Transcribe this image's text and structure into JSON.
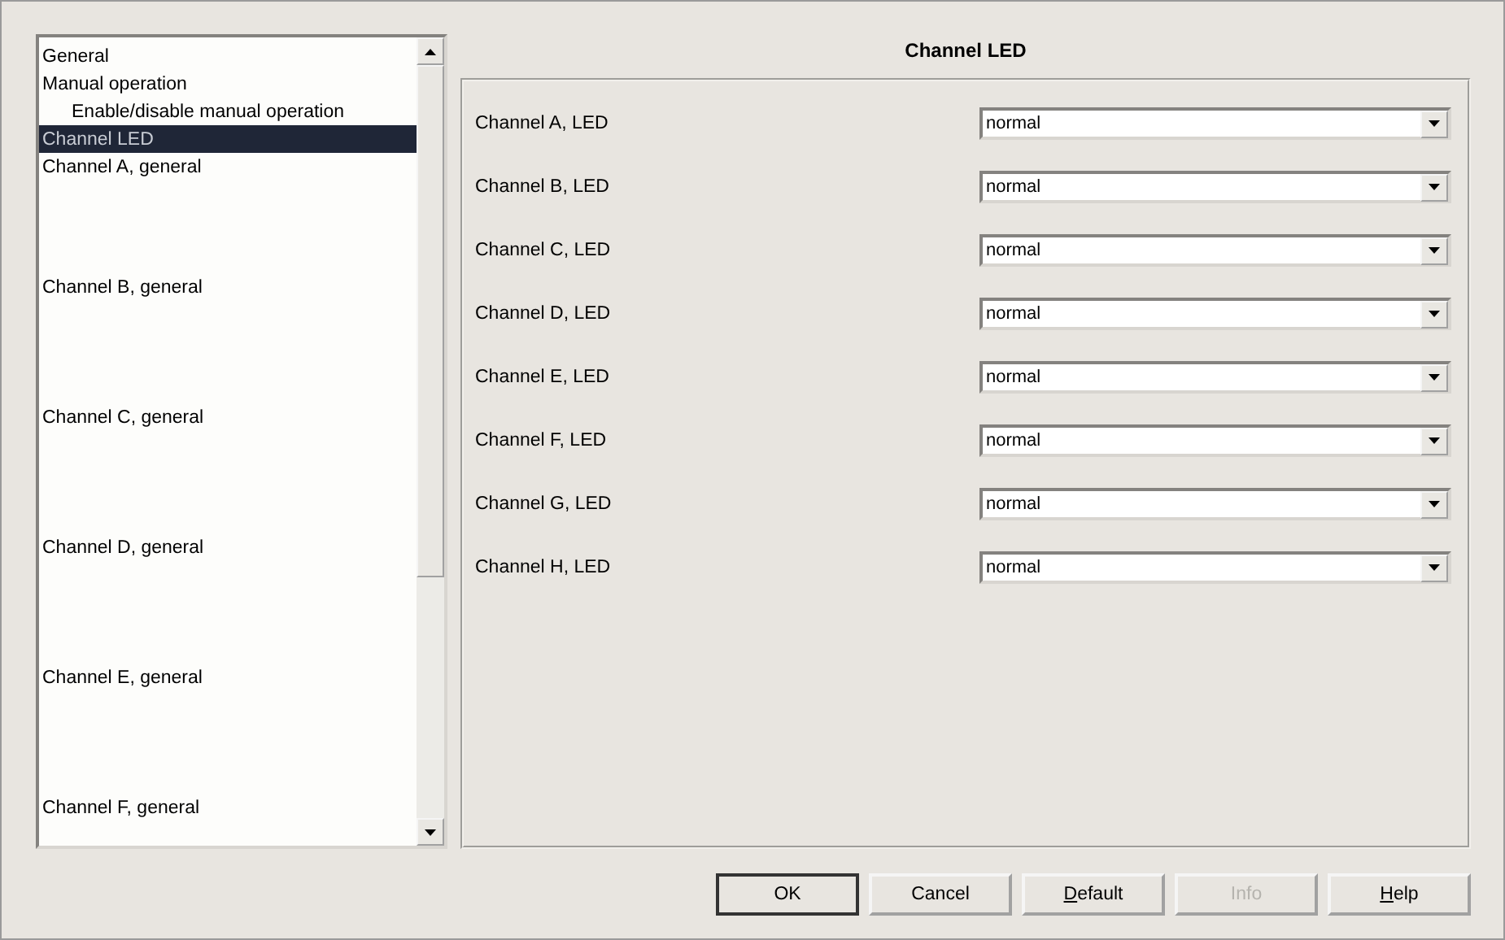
{
  "tree": {
    "items": [
      {
        "label": "General",
        "kind": "line",
        "indented": false,
        "selected": false
      },
      {
        "label": "Manual operation",
        "kind": "line",
        "indented": false,
        "selected": false
      },
      {
        "label": "Enable/disable manual operation",
        "kind": "line",
        "indented": true,
        "selected": false
      },
      {
        "label": "Channel LED",
        "kind": "line",
        "indented": false,
        "selected": true
      },
      {
        "label": "Channel A, general",
        "kind": "line",
        "indented": false,
        "selected": false
      },
      {
        "label": "Channel B, general",
        "kind": "block",
        "indented": false,
        "selected": false
      },
      {
        "label": "Channel C, general",
        "kind": "block",
        "indented": false,
        "selected": false
      },
      {
        "label": "Channel D, general",
        "kind": "block",
        "indented": false,
        "selected": false
      },
      {
        "label": "Channel E, general",
        "kind": "block",
        "indented": false,
        "selected": false
      },
      {
        "label": "Channel F, general",
        "kind": "block",
        "indented": false,
        "selected": false
      }
    ]
  },
  "panel": {
    "title": "Channel LED",
    "rows": [
      {
        "label": "Channel A, LED",
        "value": "normal"
      },
      {
        "label": "Channel B, LED",
        "value": "normal"
      },
      {
        "label": "Channel C, LED",
        "value": "normal"
      },
      {
        "label": "Channel D, LED",
        "value": "normal"
      },
      {
        "label": "Channel E, LED",
        "value": "normal"
      },
      {
        "label": "Channel F, LED",
        "value": "normal"
      },
      {
        "label": "Channel G, LED",
        "value": "normal"
      },
      {
        "label": "Channel H, LED",
        "value": "normal"
      }
    ]
  },
  "buttons": [
    {
      "label": "OK",
      "default": true,
      "disabled": false,
      "mnemonic": false
    },
    {
      "label": "Cancel",
      "default": false,
      "disabled": false,
      "mnemonic": false
    },
    {
      "label": "Default",
      "default": false,
      "disabled": false,
      "mnemonic": true
    },
    {
      "label": "Info",
      "default": false,
      "disabled": true,
      "mnemonic": false
    },
    {
      "label": "Help",
      "default": false,
      "disabled": false,
      "mnemonic": true
    }
  ]
}
